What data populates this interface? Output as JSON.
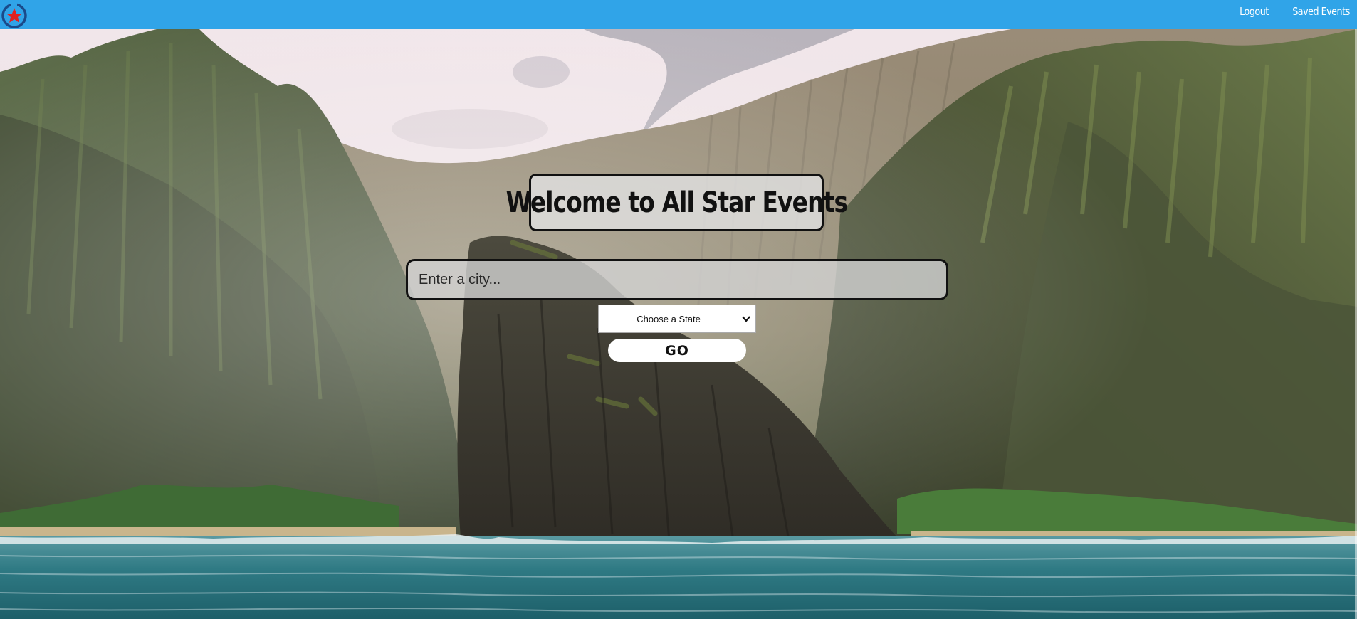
{
  "navbar": {
    "logo": "star-logo-icon",
    "links": [
      "Logout",
      "Saved Events"
    ],
    "color": "#30a4e8"
  },
  "hero": {
    "title": "Welcome to All Star Events",
    "city_input": {
      "placeholder": "Enter a city...",
      "value": ""
    },
    "state_select": {
      "selected": "Choose a State"
    },
    "go_label": "GO"
  }
}
